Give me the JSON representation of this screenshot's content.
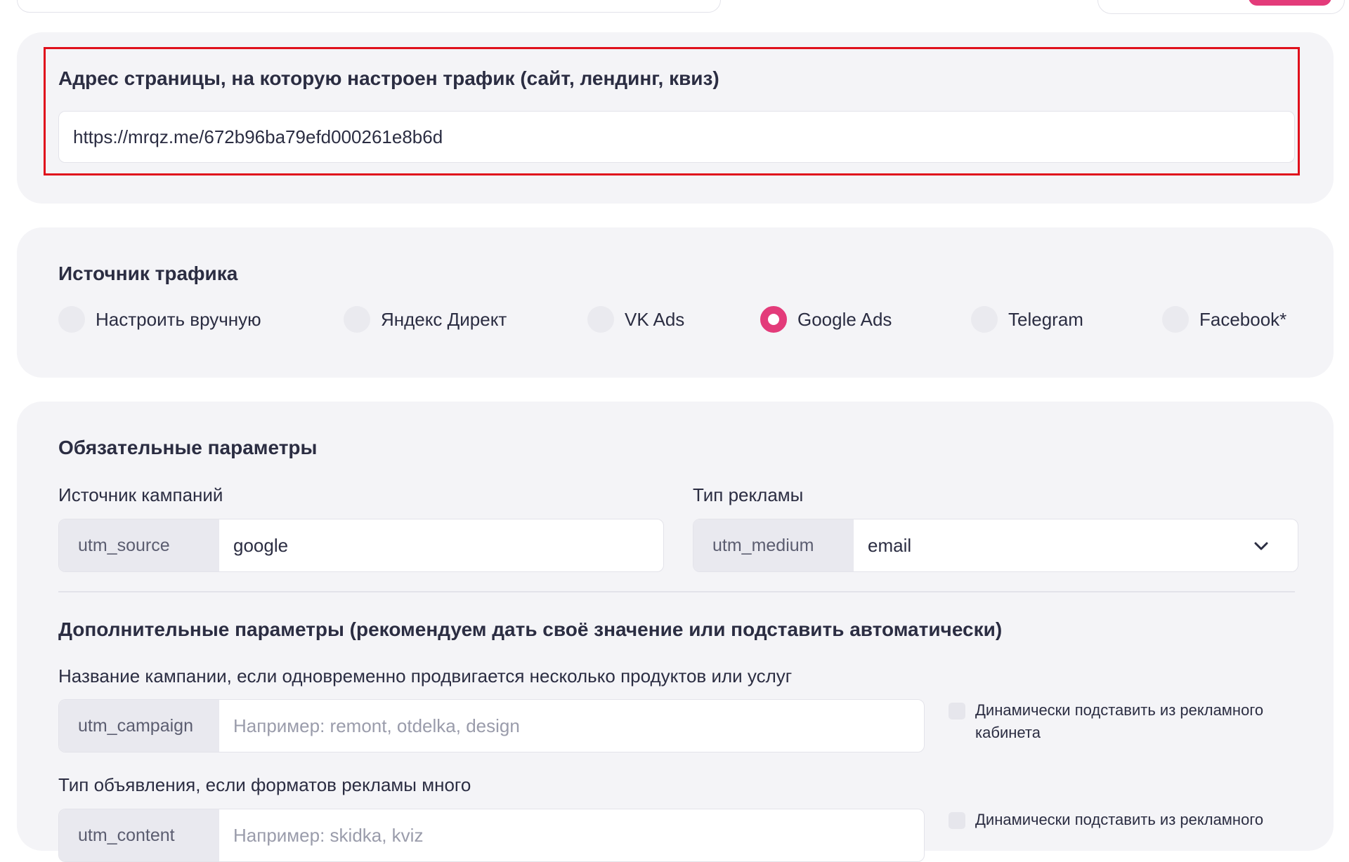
{
  "colors": {
    "accent": "#e33b7a",
    "highlight_border": "#e0101c",
    "card_bg": "#f4f4f7"
  },
  "page_url": {
    "title": "Адрес страницы, на которую настроен трафик  (сайт, лендинг, квиз)",
    "value": "https://mrqz.me/672b96ba79efd000261e8b6d"
  },
  "traffic_source": {
    "title": "Источник трафика",
    "options": [
      {
        "label": "Настроить вручную",
        "checked": false
      },
      {
        "label": "Яндекс Директ",
        "checked": false
      },
      {
        "label": "VK Ads",
        "checked": false
      },
      {
        "label": "Google Ads",
        "checked": true
      },
      {
        "label": "Telegram",
        "checked": false
      },
      {
        "label": "Facebook*",
        "checked": false
      }
    ]
  },
  "required": {
    "title": "Обязательные параметры",
    "source": {
      "label": "Источник кампаний",
      "prefix": "utm_source",
      "value": "google"
    },
    "medium": {
      "label": "Тип рекламы",
      "prefix": "utm_medium",
      "value": "email",
      "icon": "chevron-down-icon"
    }
  },
  "additional": {
    "title": "Дополнительные параметры (рекомендуем дать своё значение или подставить автоматически)",
    "campaign": {
      "label": "Название кампании, если одновременно продвигается несколько продуктов или услуг",
      "prefix": "utm_campaign",
      "placeholder": "Например: remont, otdelka, design",
      "dynamic_label": "Динамически подставить из рекламного кабинета"
    },
    "content": {
      "label": "Тип объявления, если форматов рекламы много",
      "prefix": "utm_content",
      "placeholder": "Например: skidka, kviz",
      "dynamic_label": "Динамически подставить из рекламного"
    }
  }
}
